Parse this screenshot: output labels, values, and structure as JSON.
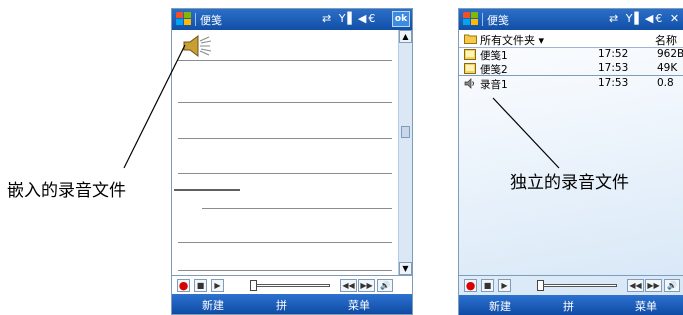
{
  "left_device": {
    "title": "便笺",
    "status_icons": "⇄ Y▌◀€",
    "ok_label": "ok",
    "menu": {
      "new_label": "新建",
      "middle_label": "拼",
      "menu_label": "菜单"
    },
    "player_buttons": [
      "●",
      "■",
      "▶",
      "◀◀",
      "▶▶",
      "🔊"
    ],
    "embedded_icon": "speaker-icon"
  },
  "right_device": {
    "title": "便笺",
    "status_icons": "⇄ Y▌◀€ ✕",
    "folder_label": "所有文件夹 ▾",
    "column_name": "名称",
    "files": [
      {
        "name": "便笺1",
        "time": "17:52",
        "size": "962B",
        "icon": "note-icon"
      },
      {
        "name": "便笺2",
        "time": "17:53",
        "size": "49K",
        "icon": "note-icon"
      },
      {
        "name": "录音1",
        "time": "17:53",
        "size": "0.8",
        "icon": "audio-icon"
      }
    ],
    "menu": {
      "new_label": "新建",
      "middle_label": "拼",
      "menu_label": "菜单"
    }
  },
  "annotations": {
    "left_label": "嵌入的录音文件",
    "right_label": "独立的录音文件"
  }
}
